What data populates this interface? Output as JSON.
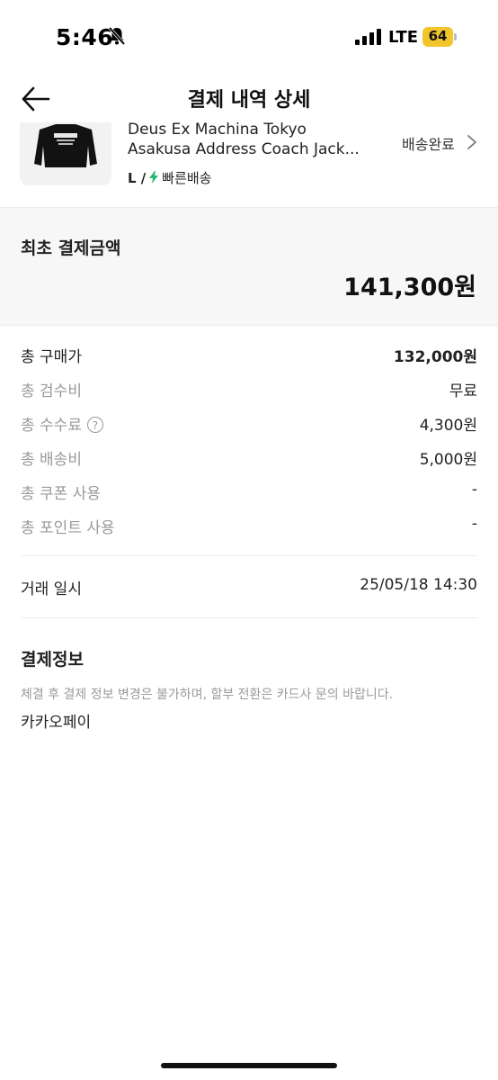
{
  "status_bar": {
    "time": "5:46",
    "network": "LTE",
    "battery": "64",
    "battery_color": "#f3c52d",
    "icons": [
      "bell-slash-icon",
      "signal-icon",
      "battery-icon"
    ]
  },
  "header": {
    "title": "결제 내역 상세",
    "back_icon": "arrow-left-icon"
  },
  "product": {
    "name_line1": "Deus Ex Machina Tokyo",
    "name_line2": "Asakusa Address Coach Jack...",
    "size": "L /",
    "shipping_type": "빠른배송",
    "shipping_color": "#2bb673",
    "status": "배송완료",
    "status_icon": "chevron-right-icon"
  },
  "initial_payment": {
    "label": "최초 결제금액",
    "amount": "141,300원"
  },
  "breakdown": [
    {
      "label": "총 구매가",
      "value": "132,000원"
    },
    {
      "label": "총 검수비",
      "value": "무료"
    },
    {
      "label": "총 수수료",
      "value": "4,300원",
      "help_icon": "question-circle-icon",
      "help_text": "?"
    },
    {
      "label": "총 배송비",
      "value": "5,000원"
    },
    {
      "label": "총 쿠폰 사용",
      "value": "-"
    },
    {
      "label": "총 포인트 사용",
      "value": "-"
    }
  ],
  "trade": {
    "label": "거래 일시",
    "value": "25/05/18 14:30"
  },
  "payment_info": {
    "title": "결제정보",
    "note": "체결 후 결제 정보 변경은 불가하며, 할부 전환은 카드사 문의 바랍니다.",
    "method": "카카오페이"
  }
}
